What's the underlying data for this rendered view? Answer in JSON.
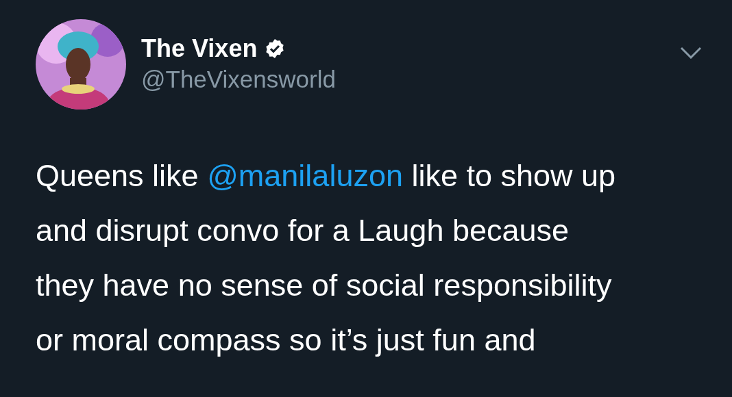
{
  "author": {
    "name": "The Vixen",
    "verified": true,
    "handle": "@TheVixensworld"
  },
  "tweet": {
    "segments": [
      {
        "kind": "text",
        "text": "Queens like "
      },
      {
        "kind": "mention",
        "text": "@manilaluzon"
      },
      {
        "kind": "text",
        "text": " like to show up"
      },
      {
        "kind": "break"
      },
      {
        "kind": "text",
        "text": "and disrupt convo for a Laugh because"
      },
      {
        "kind": "break"
      },
      {
        "kind": "text",
        "text": "they have no sense of social responsibility"
      },
      {
        "kind": "break"
      },
      {
        "kind": "text",
        "text": "or moral compass so it’s just fun and"
      }
    ]
  }
}
